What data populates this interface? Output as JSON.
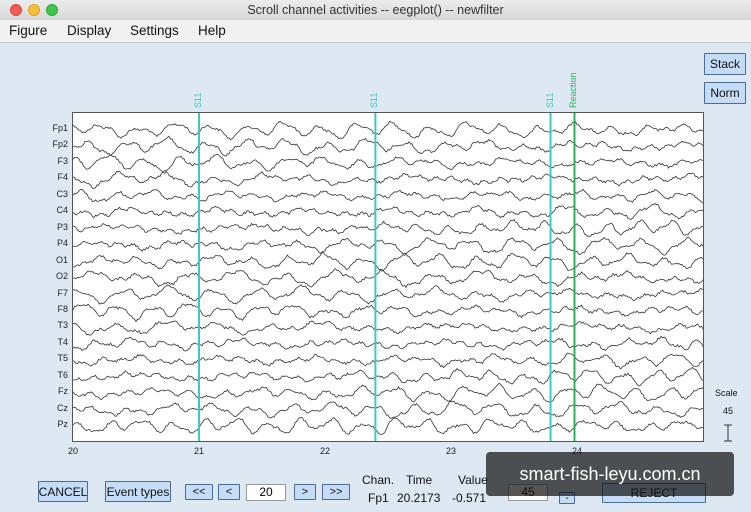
{
  "window": {
    "title": "Scroll channel activities -- eegplot() -- newfilter"
  },
  "menu": [
    "Figure",
    "Display",
    "Settings",
    "Help"
  ],
  "side_buttons": {
    "stack": "Stack",
    "norm": "Norm"
  },
  "channels": [
    "Fp1",
    "Fp2",
    "F3",
    "F4",
    "C3",
    "C4",
    "P3",
    "P4",
    "O1",
    "O2",
    "F7",
    "F8",
    "T3",
    "T4",
    "T5",
    "T6",
    "Fz",
    "Cz",
    "Pz"
  ],
  "xaxis_ticks": [
    "20",
    "21",
    "22",
    "23",
    "24"
  ],
  "events": [
    {
      "label": "S11",
      "time": 21.0,
      "color": "#3ec9c0"
    },
    {
      "label": "S11",
      "time": 22.4,
      "color": "#3ec9c0"
    },
    {
      "label": "S11",
      "time": 23.79,
      "color": "#3ec9c0"
    },
    {
      "label": "Reaction",
      "time": 23.98,
      "color": "#2bb05a"
    }
  ],
  "scale": {
    "label": "Scale",
    "value": "45"
  },
  "bottom": {
    "cancel": "CANCEL",
    "event_types": "Event types",
    "prev_page": "<<",
    "prev": "<",
    "position": "20",
    "next": ">",
    "next_page": ">>",
    "chan_header": "Chan.",
    "time_header": "Time",
    "value_header": "Value",
    "chan_value": "Fp1",
    "time_value": "20.2173",
    "value_value": "-0.571",
    "scale_input": "45",
    "minus": "-",
    "reject": "REJECT"
  },
  "watermark": "smart-fish-leyu.com.cn",
  "chart_data": {
    "type": "line",
    "x_range": [
      20,
      25
    ],
    "x_ticks": [
      20,
      21,
      22,
      23,
      24
    ],
    "series_names": [
      "Fp1",
      "Fp2",
      "F3",
      "F4",
      "C3",
      "C4",
      "P3",
      "P4",
      "O1",
      "O2",
      "F7",
      "F8",
      "T3",
      "T4",
      "T5",
      "T6",
      "Fz",
      "Cz",
      "Pz"
    ]
  }
}
